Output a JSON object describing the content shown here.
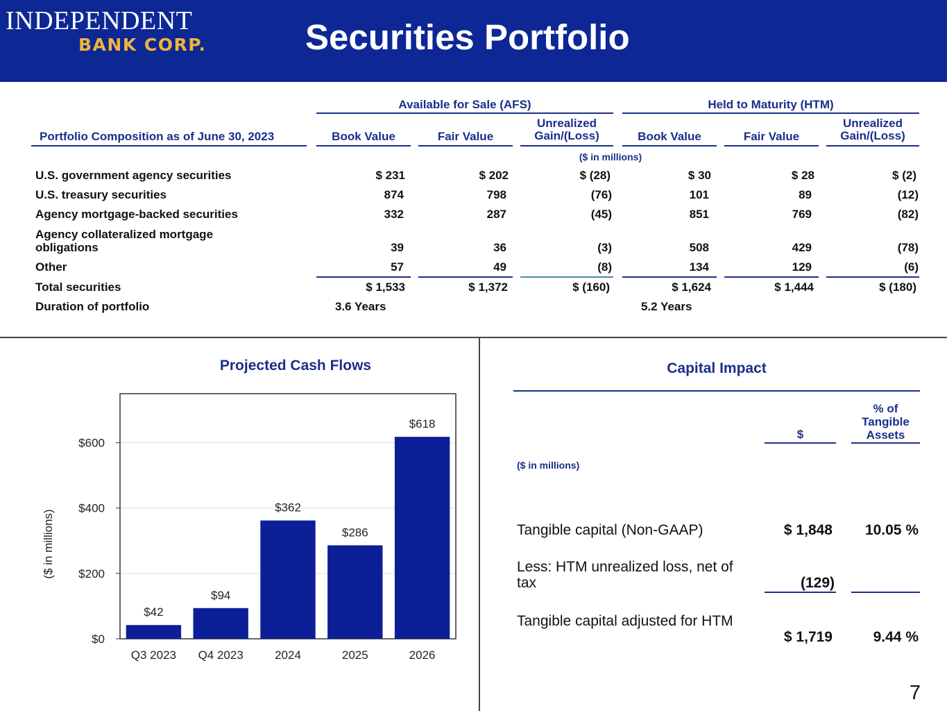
{
  "header": {
    "logo_line1": "INDEPENDENT",
    "logo_line2": "BANK CORP.",
    "title": "Securities Portfolio"
  },
  "portfolio": {
    "row_header": "Portfolio Composition as of June 30, 2023",
    "afs_header": "Available for Sale (AFS)",
    "htm_header": "Held to Maturity (HTM)",
    "col_book": "Book Value",
    "col_fair": "Fair Value",
    "col_unreal": "Unrealized Gain/(Loss)",
    "units": "($ in millions)",
    "rows": [
      {
        "label": "U.S. government agency securities",
        "cells": [
          "$ 231",
          "$ 202",
          "$ (28)",
          "$ 30",
          "$ 28",
          "$ (2)"
        ]
      },
      {
        "label": "U.S. treasury securities",
        "cells": [
          "874",
          "798",
          "(76)",
          "101",
          "89",
          "(12)"
        ]
      },
      {
        "label": "Agency mortgage-backed securities",
        "cells": [
          "332",
          "287",
          "(45)",
          "851",
          "769",
          "(82)"
        ]
      },
      {
        "label": "Agency collateralized mortgage obligations",
        "cells": [
          "39",
          "36",
          "(3)",
          "508",
          "429",
          "(78)"
        ]
      },
      {
        "label": "Other",
        "cells": [
          "57",
          "49",
          "(8)",
          "134",
          "129",
          "(6)"
        ]
      },
      {
        "label": "Total  securities",
        "cells": [
          "$ 1,533",
          "$ 1,372",
          "$ (160)",
          "$ 1,624",
          "$ 1,444",
          "$ (180)"
        ]
      }
    ],
    "duration_label": "Duration of portfolio",
    "duration_afs": "3.6 Years",
    "duration_htm": "5.2 Years"
  },
  "cash_flows": {
    "title": "Projected Cash Flows"
  },
  "chart_data": {
    "type": "bar",
    "title": "Projected Cash Flows",
    "categories": [
      "Q3 2023",
      "Q4 2023",
      "2024",
      "2025",
      "2026"
    ],
    "values": [
      42,
      94,
      362,
      286,
      618
    ],
    "data_labels": [
      "$42",
      "$94",
      "$362",
      "$286",
      "$618"
    ],
    "ylabel": "($ in millions)",
    "xlabel": "",
    "ylim": [
      0,
      750
    ],
    "yticks": [
      0,
      200,
      400,
      600
    ],
    "ytick_labels": [
      "$0",
      "$200",
      "$400",
      "$600"
    ],
    "grid": true,
    "bar_color": "#0d1f96"
  },
  "capital_impact": {
    "title": "Capital Impact",
    "col_dollar": "$",
    "col_pct": "% of Tangible Assets",
    "units": "($ in millions)",
    "rows": [
      {
        "label": "Tangible capital (Non-GAAP)",
        "value": "$ 1,848",
        "pct": "10.05 %"
      },
      {
        "label": "Less: HTM unrealized loss, net of tax",
        "value": "(129)",
        "pct": ""
      },
      {
        "label": "Tangible capital adjusted for HTM",
        "value": "$ 1,719",
        "pct": "9.44 %"
      }
    ]
  },
  "page_number": "7",
  "colors": {
    "banner": "#0d2795",
    "accent_blue": "#1a2e8a",
    "logo_gold": "#f0b43c"
  }
}
